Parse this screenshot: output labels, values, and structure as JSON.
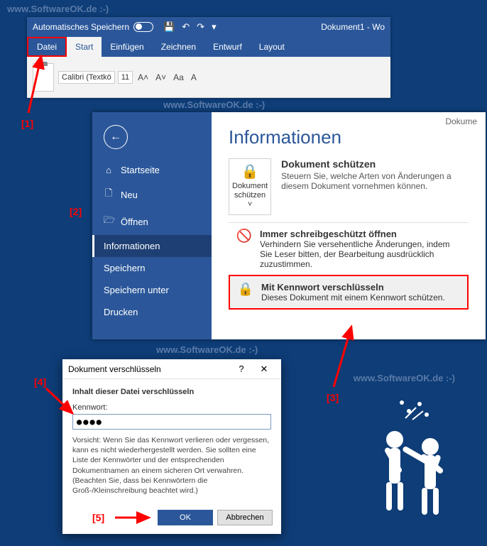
{
  "watermark": "www.SoftwareOK.de :-)",
  "ribbon": {
    "autosave_label": "Automatisches Speichern",
    "doc_title": "Dokument1 - Wo",
    "tabs": {
      "datei": "Datei",
      "start": "Start",
      "einfuegen": "Einfügen",
      "zeichnen": "Zeichnen",
      "entwurf": "Entwurf",
      "layout": "Layout"
    },
    "font_name": "Calibri (Textkö",
    "font_size": "11",
    "btn_grow": "A˄",
    "btn_shrink": "A˅",
    "btn_case": "Aa",
    "btn_clear": "A"
  },
  "backstage": {
    "doc_label": "Dokume",
    "title": "Informationen",
    "items": {
      "startseite": "Startseite",
      "neu": "Neu",
      "oeffnen": "Öffnen",
      "informationen": "Informationen",
      "speichern": "Speichern",
      "speichern_unter": "Speichern unter",
      "drucken": "Drucken"
    },
    "protect": {
      "button": "Dokument schützen",
      "heading": "Dokument schützen",
      "desc": "Steuern Sie, welche Arten von Änderungen a diesem Dokument vornehmen können."
    },
    "menu": {
      "readonly_title": "Immer schreibgeschützt öffnen",
      "readonly_desc": "Verhindern Sie versehentliche Änderungen, indem Sie Leser bitten, der Bearbeitung ausdrücklich zuzustimmen.",
      "encrypt_title": "Mit Kennwort verschlüsseln",
      "encrypt_desc": "Dieses Dokument mit einem Kennwort schützen."
    }
  },
  "dialog": {
    "title": "Dokument verschlüsseln",
    "heading": "Inhalt dieser Datei verschlüsseln",
    "pwd_label": "Kennwort:",
    "pwd_value": "●●●●",
    "warning": "Vorsicht: Wenn Sie das Kennwort verlieren oder vergessen, kann es nicht wiederhergestellt werden. Sie sollten eine Liste der Kennwörter und der entsprechenden Dokumentnamen an einem sicheren Ort verwahren.",
    "note": "(Beachten Sie, dass bei Kennwörtern die Groß-/Kleinschreibung beachtet wird.)",
    "ok": "OK",
    "cancel": "Abbrechen"
  },
  "annotations": {
    "n1": "[1]",
    "n2": "[2]",
    "n3": "[3]",
    "n4": "[4]",
    "n5": "[5]"
  }
}
